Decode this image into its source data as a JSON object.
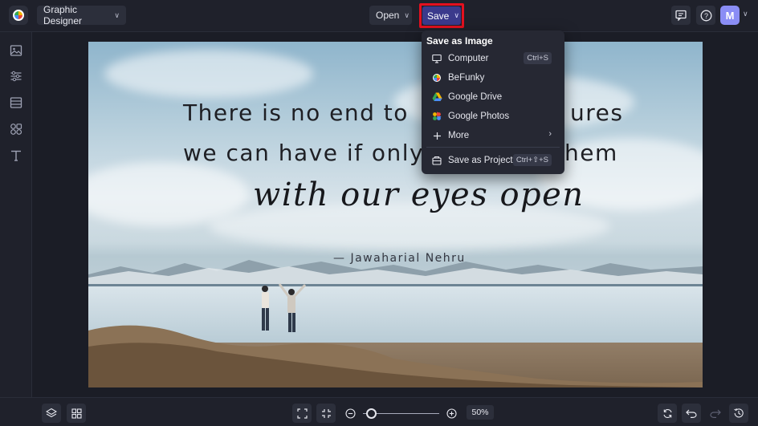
{
  "header": {
    "app_mode_label": "Graphic Designer",
    "open_label": "Open",
    "save_label": "Save",
    "avatar_initial": "M"
  },
  "save_menu": {
    "title": "Save as Image",
    "items": [
      {
        "label": "Computer",
        "shortcut": "Ctrl+S",
        "icon": "monitor-icon"
      },
      {
        "label": "BeFunky",
        "icon": "befunky-icon"
      },
      {
        "label": "Google Drive",
        "icon": "google-drive-icon"
      },
      {
        "label": "Google Photos",
        "icon": "google-photos-icon"
      },
      {
        "label": "More",
        "icon": "plus-icon"
      },
      {
        "label": "Save as Project",
        "shortcut": "Ctrl+⇧+S",
        "icon": "project-icon"
      }
    ]
  },
  "canvas": {
    "quote_line_1": "There is no end to",
    "quote_line_1_end": "ures",
    "quote_line_2": "we can have if only",
    "quote_line_2_end": "hem",
    "quote_line_3": "with our eyes open",
    "author": "— Jawaharial Nehru"
  },
  "footer": {
    "zoom_percent": "50%",
    "zoom_level": 0.1
  },
  "colors": {
    "accent": "#3b3a8c",
    "highlight_border": "#e4101f",
    "avatar": "#8a8df5"
  }
}
